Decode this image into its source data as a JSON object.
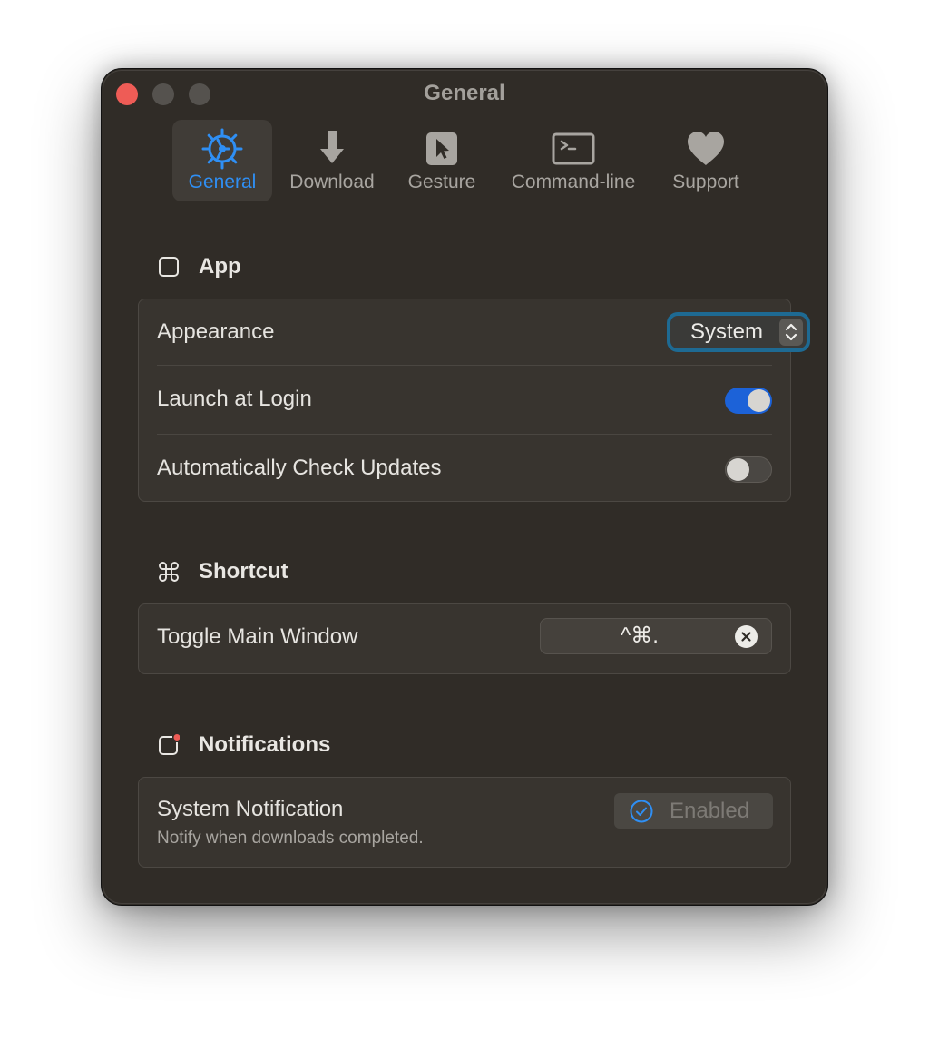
{
  "window": {
    "title": "General"
  },
  "toolbar": {
    "items": [
      {
        "label": "General",
        "icon": "gear-icon",
        "selected": true
      },
      {
        "label": "Download",
        "icon": "download-arrow-icon",
        "selected": false
      },
      {
        "label": "Gesture",
        "icon": "cursor-icon",
        "selected": false
      },
      {
        "label": "Command-line",
        "icon": "terminal-icon",
        "selected": false
      },
      {
        "label": "Support",
        "icon": "heart-icon",
        "selected": false
      }
    ]
  },
  "sections": {
    "app": {
      "title": "App",
      "icon": "square-icon",
      "appearance_label": "Appearance",
      "appearance_value": "System",
      "launch_label": "Launch at Login",
      "launch_on": true,
      "updates_label": "Automatically Check Updates",
      "updates_on": false
    },
    "shortcut": {
      "title": "Shortcut",
      "icon": "command-icon",
      "toggle_label": "Toggle Main Window",
      "keys": "^⌘."
    },
    "notifications": {
      "title": "Notifications",
      "icon": "notification-badge-icon",
      "system_label": "System Notification",
      "system_sub": "Notify when downloads completed.",
      "enabled_label": "Enabled"
    }
  },
  "colors": {
    "accent": "#2f8ff4",
    "toggle_on": "#1c62d8",
    "close_button": "#ee5c56",
    "focus_ring": "#1e6a93"
  }
}
